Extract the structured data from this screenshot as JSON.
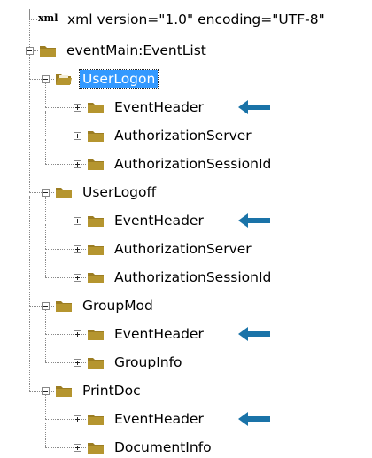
{
  "declaration": {
    "tag": "xml",
    "text": "xml version=\"1.0\" encoding=\"UTF-8\""
  },
  "root": {
    "label": "eventMain:EventList",
    "expanded": true
  },
  "events": [
    {
      "label": "UserLogon",
      "selected": true,
      "expanded": true,
      "children": [
        "EventHeader",
        "AuthorizationServer",
        "AuthorizationSessionId"
      ]
    },
    {
      "label": "UserLogoff",
      "selected": false,
      "expanded": true,
      "children": [
        "EventHeader",
        "AuthorizationServer",
        "AuthorizationSessionId"
      ]
    },
    {
      "label": "GroupMod",
      "selected": false,
      "expanded": true,
      "children": [
        "EventHeader",
        "GroupInfo"
      ]
    },
    {
      "label": "PrintDoc",
      "selected": false,
      "expanded": true,
      "children": [
        "EventHeader",
        "DocumentInfo"
      ]
    }
  ],
  "colors": {
    "selection": "#3399ff",
    "arrow": "#1a73a8",
    "folder": "#b5952f"
  },
  "icons": {
    "folder": "folder-icon",
    "open_folder": "open-folder-icon",
    "expand": "expand-plus-icon",
    "collapse": "collapse-minus-icon",
    "pointer": "pointer-arrow-icon"
  }
}
